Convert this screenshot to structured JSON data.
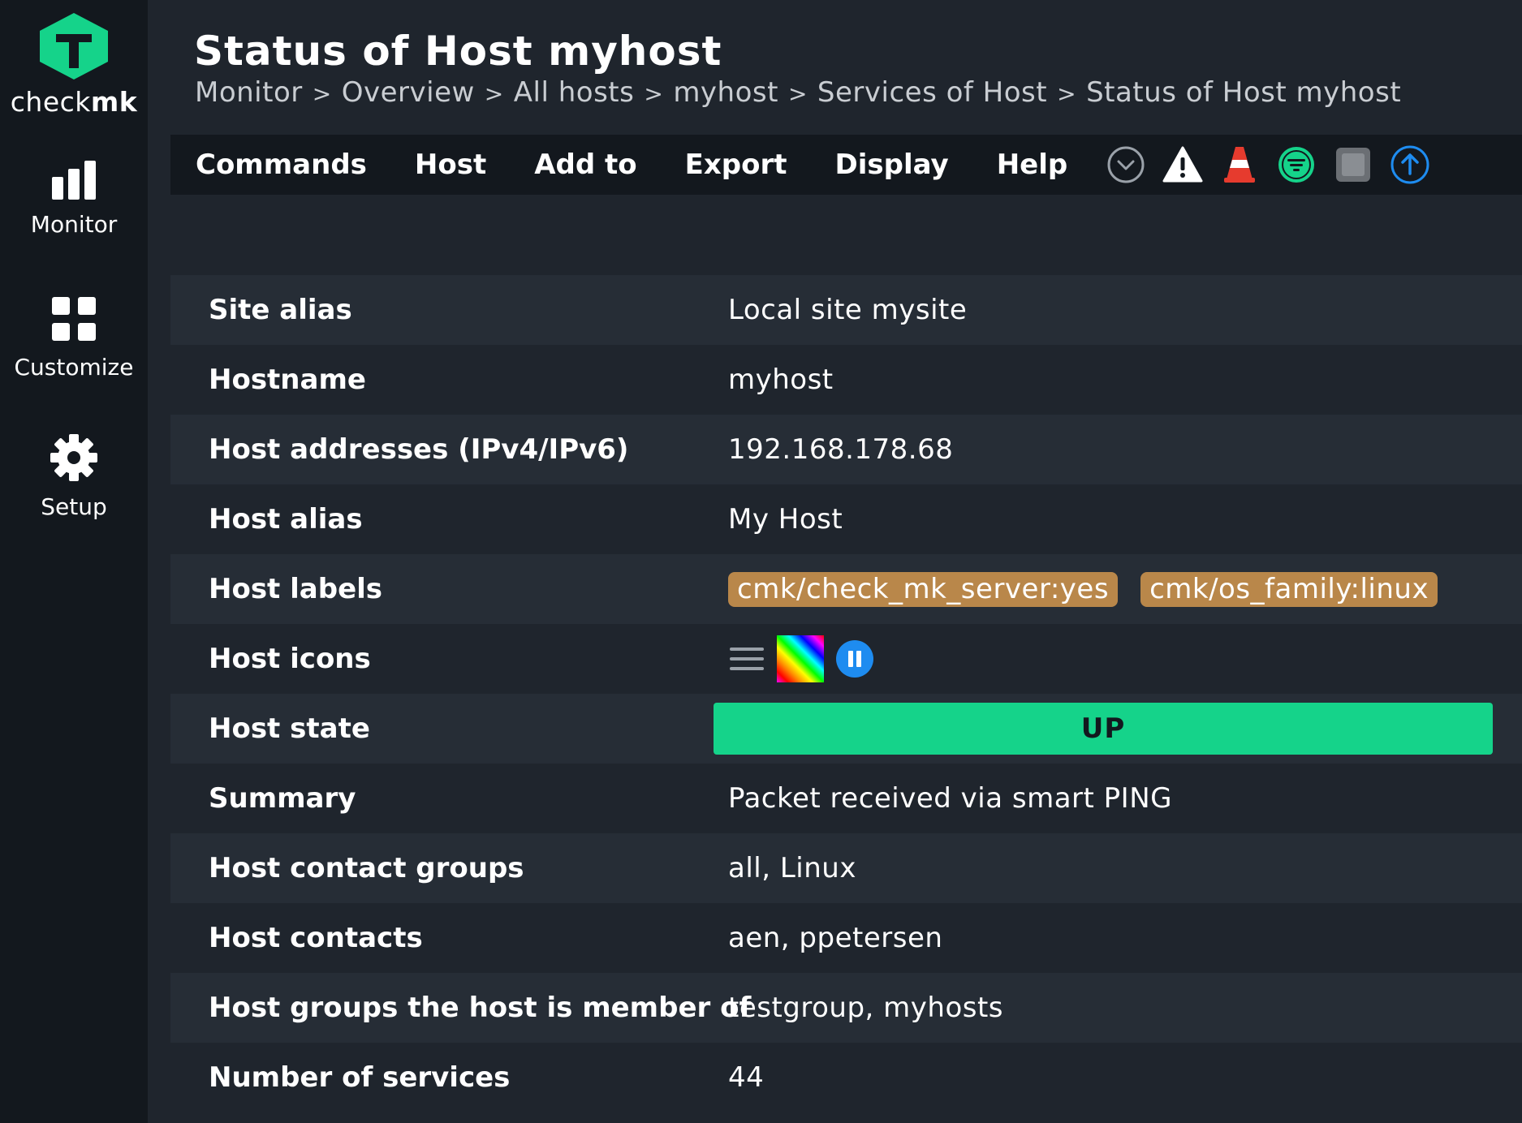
{
  "app": {
    "logo_text_light": "check",
    "logo_text_bold": "mk",
    "brand_color": "#15d38a"
  },
  "sidebar": {
    "items": [
      {
        "label": "Monitor",
        "icon": "bar-chart-icon"
      },
      {
        "label": "Customize",
        "icon": "grid-icon"
      },
      {
        "label": "Setup",
        "icon": "gear-icon"
      }
    ]
  },
  "header": {
    "title": "Status of Host myhost",
    "breadcrumb": [
      "Monitor",
      "Overview",
      "All hosts",
      "myhost",
      "Services of Host",
      "Status of Host myhost"
    ],
    "separator": ">"
  },
  "menubar": {
    "items": [
      "Commands",
      "Host",
      "Add to",
      "Export",
      "Display",
      "Help"
    ],
    "icons": [
      "chevron-down-circle-icon",
      "warning-icon",
      "traffic-cone-icon",
      "filter-icon",
      "stop-icon",
      "upload-circle-icon"
    ]
  },
  "table": {
    "rows": [
      {
        "label": "Site alias",
        "value": "Local site mysite"
      },
      {
        "label": "Hostname",
        "value": "myhost"
      },
      {
        "label": "Host addresses (IPv4/IPv6)",
        "value": "192.168.178.68"
      },
      {
        "label": "Host alias",
        "value": "My Host"
      },
      {
        "label": "Host labels",
        "tags": [
          "cmk/check_mk_server:yes",
          "cmk/os_family:linux"
        ]
      },
      {
        "label": "Host icons",
        "icons": [
          "menu-icon",
          "rainbow-icon",
          "pause-icon"
        ]
      },
      {
        "label": "Host state",
        "state": "UP",
        "state_color": "#15d38a"
      },
      {
        "label": "Summary",
        "value": "Packet received via smart PING"
      },
      {
        "label": "Host contact groups",
        "value": "all, Linux"
      },
      {
        "label": "Host contacts",
        "value": "aen, ppetersen"
      },
      {
        "label": "Host groups the host is member of",
        "value": "testgroup, myhosts"
      },
      {
        "label": "Number of services",
        "value": "44"
      }
    ]
  }
}
